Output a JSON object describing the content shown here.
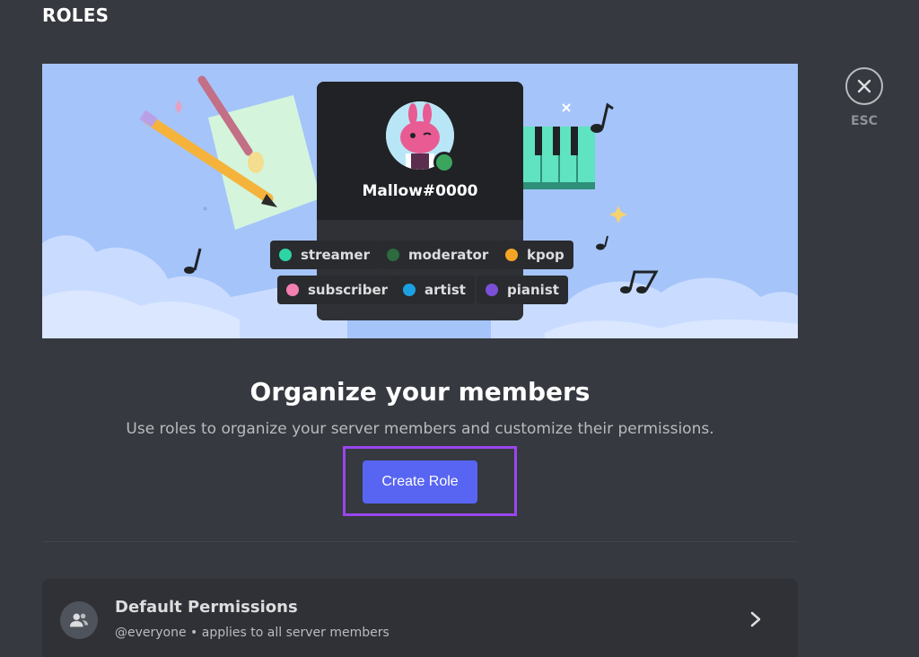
{
  "header": {
    "title": "ROLES"
  },
  "close": {
    "label": "ESC"
  },
  "banner": {
    "profile": {
      "username": "Mallow#0000"
    },
    "roles": [
      {
        "name": "streamer",
        "color": "#2dd4a6"
      },
      {
        "name": "moderator",
        "color": "#2d6a3d"
      },
      {
        "name": "kpop",
        "color": "#f5a524"
      },
      {
        "name": "subscriber",
        "color": "#f47fb1"
      },
      {
        "name": "artist",
        "color": "#1ba1e2"
      },
      {
        "name": "pianist",
        "color": "#7b4fd6"
      }
    ]
  },
  "main": {
    "headline": "Organize your members",
    "subtitle": "Use roles to organize your server members and customize their permissions.",
    "create_button": "Create Role"
  },
  "default_permissions": {
    "title": "Default Permissions",
    "subtitle": "@everyone • applies to all server members"
  },
  "colors": {
    "background": "#36393f",
    "accent": "#5865f2",
    "highlight": "#9b45f0"
  }
}
